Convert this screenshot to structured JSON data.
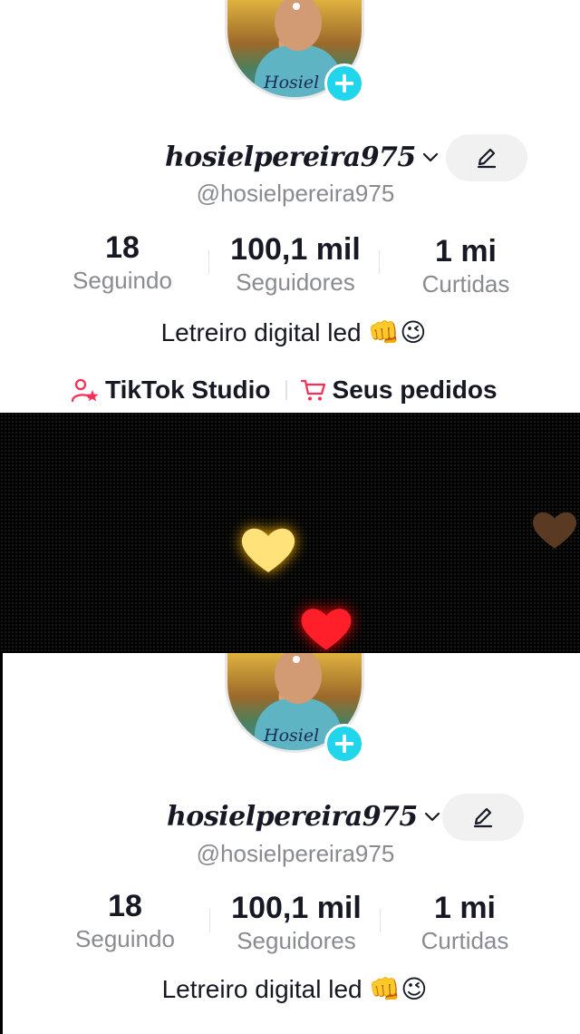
{
  "profile": {
    "avatar_signature": "Hosiel",
    "username": "hosielpereira975",
    "handle": "@hosielpereira975",
    "stats": [
      {
        "value": "18",
        "label": "Seguindo"
      },
      {
        "value": "100,1 mil",
        "label": "Seguidores"
      },
      {
        "value": "1 mi",
        "label": "Curtidas"
      }
    ],
    "bio": "Letreiro digital led",
    "bio_emoji": "👊😉",
    "links": {
      "studio": "TikTok Studio",
      "orders": "Seus pedidos"
    }
  },
  "icons": {
    "follow": "plus-icon",
    "username_menu": "chevron-down-icon",
    "edit": "pencil-icon",
    "studio": "person-star-icon",
    "orders": "shopping-cart-icon",
    "hearts": [
      "yellow-heart-icon",
      "red-heart-icon",
      "brown-heart-icon"
    ]
  },
  "colors": {
    "follow_badge": "#20d5ec",
    "brand_pink": "#fe2c55",
    "text_primary": "#161823",
    "text_secondary": "#8a8b91",
    "led_background": "#030303",
    "heart_yellow": "#ffe27a",
    "heart_red": "#ff1f2a",
    "heart_brown": "#5a3a22"
  }
}
